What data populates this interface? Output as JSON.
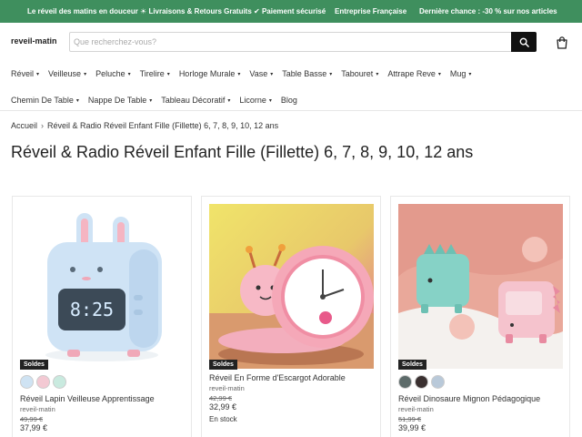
{
  "announcement": {
    "left": "Le réveil des matins en douceur ☀ Livraisons & Retours Gratuits ✔ Paiement sécurisé",
    "middle": "Entreprise Française",
    "right": "Dernière chance : -30 % sur nos articles"
  },
  "header": {
    "logo": "reveil-matin",
    "search_placeholder": "Que recherchez-vous?",
    "search_icon": "search-icon",
    "cart_icon": "cart-icon"
  },
  "nav": {
    "row1": [
      {
        "label": "Réveil",
        "dropdown": true
      },
      {
        "label": "Veilleuse",
        "dropdown": true
      },
      {
        "label": "Peluche",
        "dropdown": true
      },
      {
        "label": "Tirelire",
        "dropdown": true
      },
      {
        "label": "Horloge Murale",
        "dropdown": true
      },
      {
        "label": "Vase",
        "dropdown": true
      },
      {
        "label": "Table Basse",
        "dropdown": true
      },
      {
        "label": "Tabouret",
        "dropdown": true
      },
      {
        "label": "Attrape Reve",
        "dropdown": true
      },
      {
        "label": "Mug",
        "dropdown": true
      }
    ],
    "row2": [
      {
        "label": "Chemin De Table",
        "dropdown": true
      },
      {
        "label": "Nappe De Table",
        "dropdown": true
      },
      {
        "label": "Tableau Décoratif",
        "dropdown": true
      },
      {
        "label": "Licorne",
        "dropdown": true
      },
      {
        "label": "Blog",
        "dropdown": false
      }
    ],
    "chevron": "▾"
  },
  "breadcrumb": {
    "home": "Accueil",
    "separator": "›",
    "current": "Réveil & Radio Réveil Enfant Fille (Fillette) 6, 7, 8, 9, 10, 12 ans"
  },
  "page_title": "Réveil & Radio Réveil Enfant Fille (Fillette) 6, 7, 8, 9, 10, 12 ans",
  "products": [
    {
      "badge": "Soldes",
      "swatches": [
        "#cfe3f3",
        "#f3c9d3",
        "#c9eadf"
      ],
      "title": "Réveil Lapin Veilleuse Apprentissage",
      "vendor": "reveil-matin",
      "compare_price": "49,99 €",
      "price": "37,99 €",
      "stock": ""
    },
    {
      "badge": "Soldes",
      "swatches": [],
      "title": "Réveil En Forme d'Escargot Adorable",
      "vendor": "reveil-matin",
      "compare_price": "42,99 €",
      "price": "32,99 €",
      "stock": "En stock"
    },
    {
      "badge": "Soldes",
      "swatches": [
        "#5d6b6a",
        "#3a3030",
        "#b9c9d9"
      ],
      "title": "Réveil Dinosaure Mignon Pédagogique",
      "vendor": "reveil-matin",
      "compare_price": "51,99 €",
      "price": "39,99 €",
      "stock": ""
    }
  ],
  "colors": {
    "announcement_bg": "#3f8f5e",
    "search_button_bg": "#111111",
    "badge_bg": "#222222"
  }
}
